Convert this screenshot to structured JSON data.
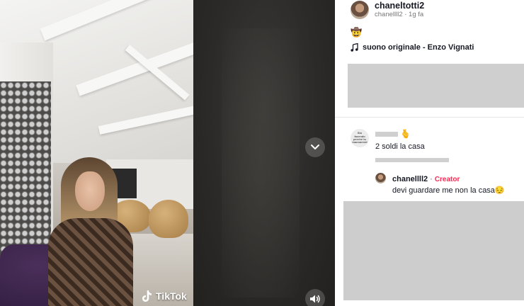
{
  "video": {
    "watermark_label": "TikTok",
    "watermark_icon": "tiktok-logo-icon",
    "next_icon": "chevron-down-icon",
    "volume_icon": "volume-icon"
  },
  "author": {
    "display_name": "chaneltotti2",
    "meta": "chanellll2 · 1g fa"
  },
  "caption": {
    "emoji": "🤠"
  },
  "music": {
    "icon": "music-note-icon",
    "label": "suono originale - Enzo Vignati"
  },
  "comments": [
    {
      "avatar_text": "Sto facendo perché tu mannaresti",
      "emoji": "🫰",
      "text": "2 soldi la casa",
      "reply": {
        "author": "chanellll2",
        "separator": "·",
        "badge": "Creator",
        "text": "devi guardare me non la casa😔"
      }
    }
  ],
  "colors": {
    "creator_badge": "#fe2c55",
    "text_primary": "#161823",
    "redaction": "#cfcfcf"
  }
}
